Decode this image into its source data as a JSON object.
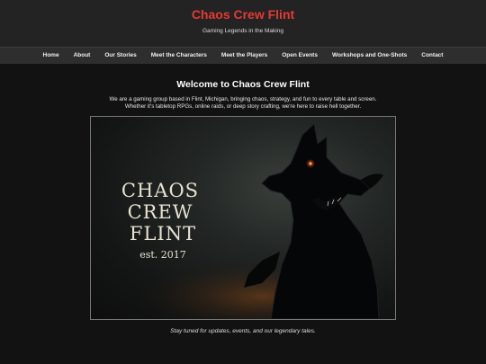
{
  "header": {
    "title": "Chaos Crew Flint",
    "tagline": "Gaming Legends in the Making"
  },
  "nav": {
    "items": [
      {
        "label": "Home"
      },
      {
        "label": "About"
      },
      {
        "label": "Our Stories"
      },
      {
        "label": "Meet the Characters"
      },
      {
        "label": "Meet the Players"
      },
      {
        "label": "Open Events"
      },
      {
        "label": "Workshops and One-Shots"
      },
      {
        "label": "Contact"
      }
    ]
  },
  "main": {
    "heading": "Welcome to Chaos Crew Flint",
    "intro_line1": "We are a gaming group based in Flint, Michigan, bringing chaos, strategy, and fun to every table and screen.",
    "intro_line2": "Whether it's tabletop RPGs, online raids, or deep story crafting, we're here to raise hell together.",
    "hero": {
      "line1": "CHAOS CREW",
      "line2": "FLINT",
      "est": "est. 2017"
    },
    "footer_note": "Stay tuned for updates, events, and our legendary tales."
  },
  "colors": {
    "accent": "#e53935",
    "background": "#121212",
    "header_bg": "#232323",
    "nav_bg": "#2e2e2e",
    "wolf_eye": "#ff5a1f"
  }
}
